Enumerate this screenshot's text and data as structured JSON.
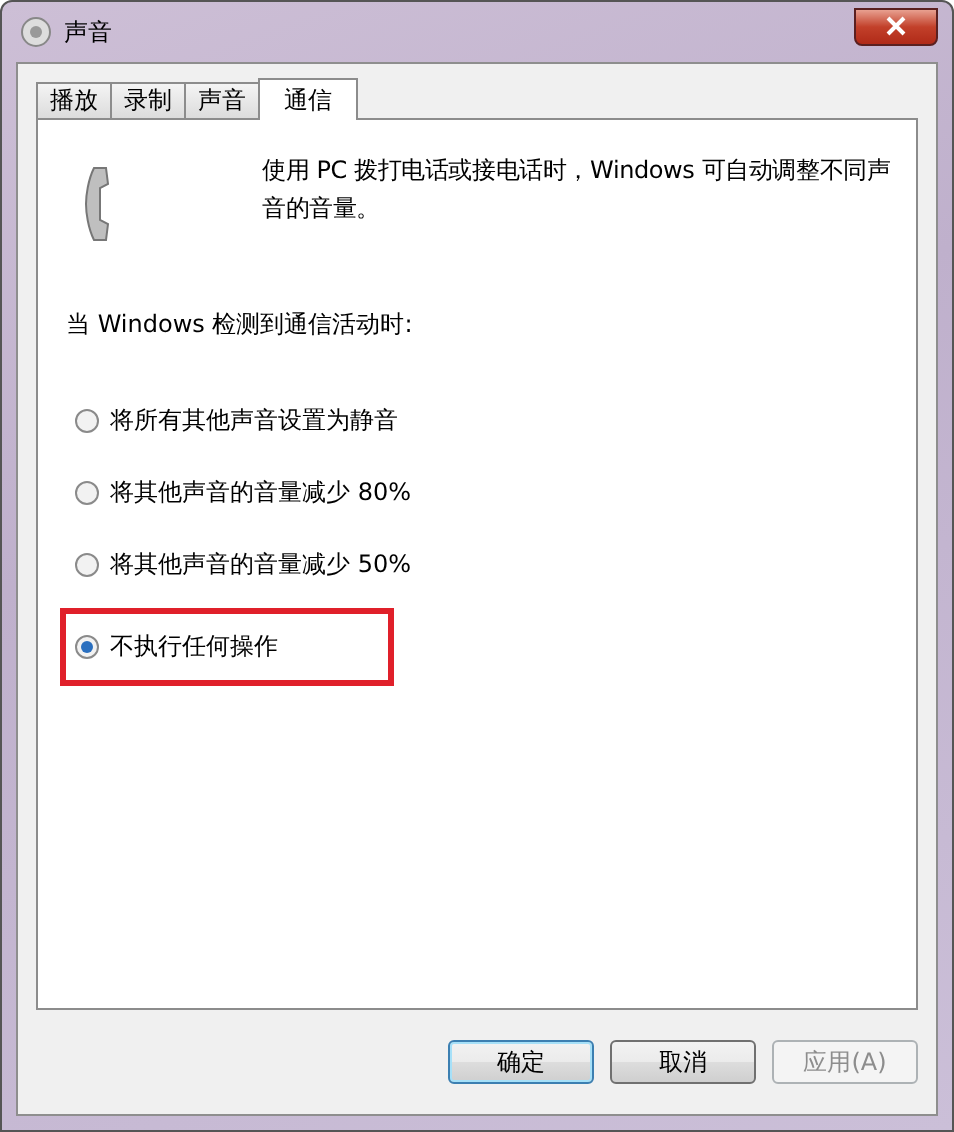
{
  "window": {
    "title": "声音"
  },
  "tabs": [
    {
      "label": "播放",
      "selected": false
    },
    {
      "label": "录制",
      "selected": false
    },
    {
      "label": "声音",
      "selected": false
    },
    {
      "label": "通信",
      "selected": true
    }
  ],
  "description": "使用 PC 拨打电话或接电话时，Windows 可自动调整不同声音的音量。",
  "prompt": "当 Windows 检测到通信活动时:",
  "options": [
    {
      "label": "将所有其他声音设置为静音",
      "selected": false,
      "highlighted": false
    },
    {
      "label": "将其他声音的音量减少 80%",
      "selected": false,
      "highlighted": false
    },
    {
      "label": "将其他声音的音量减少 50%",
      "selected": false,
      "highlighted": false
    },
    {
      "label": "不执行任何操作",
      "selected": true,
      "highlighted": true
    }
  ],
  "buttons": [
    {
      "label": "确定",
      "disabled": false,
      "default": true
    },
    {
      "label": "取消",
      "disabled": false,
      "default": false
    },
    {
      "label": "应用(A)",
      "disabled": true,
      "default": false
    }
  ]
}
